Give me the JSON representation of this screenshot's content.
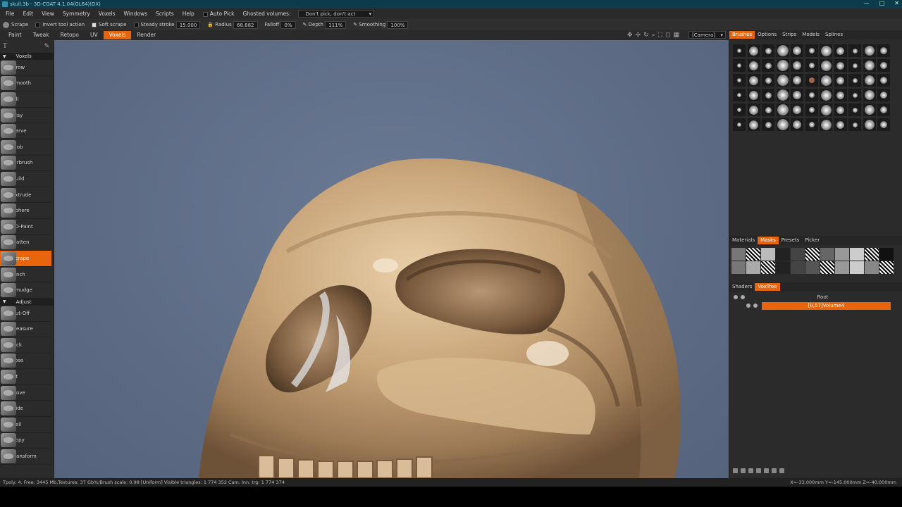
{
  "window": {
    "title": "skull.3b - 3D-COAT 4.1.04(GL64)(DX)",
    "controls": [
      "—",
      "□",
      "✕"
    ]
  },
  "menubar": {
    "items": [
      "File",
      "Edit",
      "View",
      "Symmetry",
      "Voxels",
      "Windows",
      "Scripts",
      "Help"
    ],
    "auto_pick": "Auto Pick",
    "ghosted_label": "Ghosted volumes:",
    "ghosted_value": "Don't pick, don't act"
  },
  "toolbar": {
    "tool": "Scrape",
    "invert": "Invert tool action",
    "soft": "Soft scrape",
    "steady_label": "Steady stroke",
    "steady_value": "15.000",
    "radius_label": "Radius",
    "radius_value": "68.682",
    "falloff_label": "Falloff",
    "falloff_value": "0%",
    "depth_label": "Depth",
    "depth_value": "111%",
    "smoothing_label": "Smoothing",
    "smoothing_value": "100%"
  },
  "rooms": {
    "tabs": [
      "Paint",
      "Tweak",
      "Retopo",
      "UV",
      "Voxels",
      "Render"
    ],
    "active": 4,
    "camera": "[Camera]"
  },
  "left_panel": {
    "voxels_header": "Voxels",
    "voxel_tools": [
      "Grow",
      "Smooth",
      "Fill",
      "Clay",
      "Carve",
      "Blob",
      "Airbrush",
      "Build",
      "Extrude",
      "Sphere",
      "2D-Paint",
      "Flatten",
      "Scrape",
      "Pinch",
      "Smudge"
    ],
    "active_tool": "Scrape",
    "adjust_header": "Adjust",
    "adjust_tools": [
      "Cut-Off",
      "Measure",
      "Pick",
      "Pose",
      "Fit",
      "Move",
      "Hide",
      "Cell",
      "Copy",
      "Transform"
    ]
  },
  "right_panel": {
    "top_tabs": [
      "Brushes",
      "Options",
      "Strips",
      "Models",
      "Splines"
    ],
    "top_active": 0,
    "mask_tabs": [
      "Materials",
      "Masks",
      "Presets",
      "Picker"
    ],
    "mask_active": 1,
    "tree_tabs": [
      "Shaders",
      "VoxTree"
    ],
    "tree_active": 1,
    "tree_root": "Root",
    "tree_node": "[0,57]Volume4"
  },
  "statusbar": {
    "left": "Tpoly: 4. Free: 3445 Mb,Textures: 37 Gb%/Brush scale: 0.98 [Uniform] Visible triangles: 1 774 352 Cam. Inn. trg: 1 774 374",
    "right": "X=-33.000mm Y=-145.000mm Z=-40.000mm"
  },
  "colors": {
    "accent": "#e8650e",
    "viewport_bg": "#5d6b85",
    "titlebar": "#0d3b4a"
  }
}
